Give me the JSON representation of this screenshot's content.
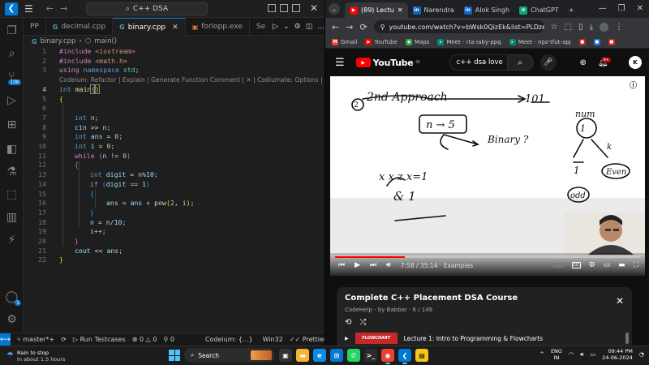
{
  "vscode": {
    "title_search": "C++ DSA",
    "menu_icon": "hamburger-icon",
    "tabs": [
      {
        "label": "PP",
        "active": false
      },
      {
        "label": "decimal.cpp",
        "active": false
      },
      {
        "label": "binary.cpp",
        "active": true
      },
      {
        "label": "forlopp.exe",
        "active": false
      },
      {
        "label": "Se",
        "active": false
      }
    ],
    "breadcrumb": {
      "file": "binary.cpp",
      "symbol": "main()"
    },
    "lines": [
      {
        "n": "1"
      },
      {
        "n": "2"
      },
      {
        "n": "3"
      },
      {
        "n": "4"
      },
      {
        "n": "5"
      },
      {
        "n": "6"
      },
      {
        "n": "7"
      },
      {
        "n": "8"
      },
      {
        "n": "9"
      },
      {
        "n": "10"
      },
      {
        "n": "11"
      },
      {
        "n": "12"
      },
      {
        "n": "13"
      },
      {
        "n": "14"
      },
      {
        "n": "15"
      },
      {
        "n": "16"
      },
      {
        "n": "17"
      },
      {
        "n": "18"
      },
      {
        "n": "19"
      },
      {
        "n": "20"
      },
      {
        "n": "21"
      },
      {
        "n": "22"
      }
    ],
    "code": {
      "l1a": "#include ",
      "l1b": "<iostream>",
      "l2a": "#include ",
      "l2b": "<math.h>",
      "l3a": "using ",
      "l3b": "namespace ",
      "l3c": "std",
      "codelens": "Codeium: Refactor | Explain | Generate Function Comment | ✕ | Codiumate: Options | Te",
      "l4a": "int ",
      "l4b": "main",
      "l7a": "int ",
      "l7b": "n",
      "l8a": "cin ",
      "l8b": ">> ",
      "l8c": "n",
      "l9a": "int ",
      "l9b": "ans ",
      "l9c": "= ",
      "l9d": "0",
      "l10a": "int ",
      "l10b": "i ",
      "l10c": "= ",
      "l10d": "0",
      "l11a": "while ",
      "l11b": "n ",
      "l11c": "!= ",
      "l11d": "0",
      "l13a": "int ",
      "l13b": "digit ",
      "l13c": "= ",
      "l13d": "n%10",
      "l14a": "if ",
      "l14b": "digit ",
      "l14c": "== ",
      "l14d": "1",
      "l16a": "ans ",
      "l16b": "= ",
      "l16c": "ans ",
      "l16d": "+ ",
      "l16e": "pow",
      "l16f": "2",
      "l16g": "i",
      "l18a": "n ",
      "l18b": "= ",
      "l18c": "n/10",
      "l19a": "i++",
      "l21a": "cout ",
      "l21b": "<< ",
      "l21c": "ans"
    },
    "status": {
      "branch": "master*+",
      "run": "Run Testcases",
      "errors": "0",
      "warnings": "0",
      "ports": "0",
      "codeium": "Codeium: {...}",
      "platform": "Win32",
      "prettier": "Prettier"
    },
    "activity_badge": "10K",
    "account_badge": "1"
  },
  "chrome": {
    "tabs": [
      {
        "label": "(89) Lectu",
        "favicon": "youtube",
        "active": true
      },
      {
        "label": "Narendra",
        "favicon": "linkedin",
        "active": false
      },
      {
        "label": "Alok Singh",
        "favicon": "linkedin",
        "active": false
      },
      {
        "label": "ChatGPT",
        "favicon": "chatgpt",
        "active": false
      }
    ],
    "url": "youtube.com/watch?v=bWsk0QizEk&list=PLDzeHZWIZs...",
    "bookmarks": [
      {
        "label": "Gmail"
      },
      {
        "label": "YouTube"
      },
      {
        "label": "Maps"
      },
      {
        "label": "Meet - rta-iaby-ppq"
      },
      {
        "label": "Meet - npz-tfut-apj"
      }
    ]
  },
  "youtube": {
    "logo": "YouTube",
    "logo_region": "IN",
    "search_value": "c++ dsa love",
    "notif_count": "9+",
    "avatar_text": "K",
    "time": "7:58 / 35:14 · Examples",
    "progress": 0.23,
    "board": {
      "approach": "2nd Approach",
      "right_num": "101",
      "box": "n → 5",
      "binary": "Binary ?",
      "num": "num",
      "xx": "x x z  x=1",
      "andone": "& 1",
      "even": "Even",
      "odd": "odd",
      "one": "1",
      "k": "k"
    },
    "playlist": {
      "title": "Complete C++ Placement DSA Course",
      "sub": "CodeHelp - by Babbar · 6 / 149",
      "item": "Lecture 1: Intro to Programming & Flowcharts",
      "thumb": "FLOWCHART"
    }
  },
  "taskbar": {
    "weather_title": "Rain to stop",
    "weather_sub": "In about 1.5 hours",
    "search": "Search",
    "lang1": "ENG",
    "lang2": "IN",
    "time": "09:44 PM",
    "date": "24-06-2024"
  },
  "colors": {
    "accent": "#0078d4",
    "youtube_red": "#ff0000",
    "editor_bg": "#1e1e1e"
  }
}
